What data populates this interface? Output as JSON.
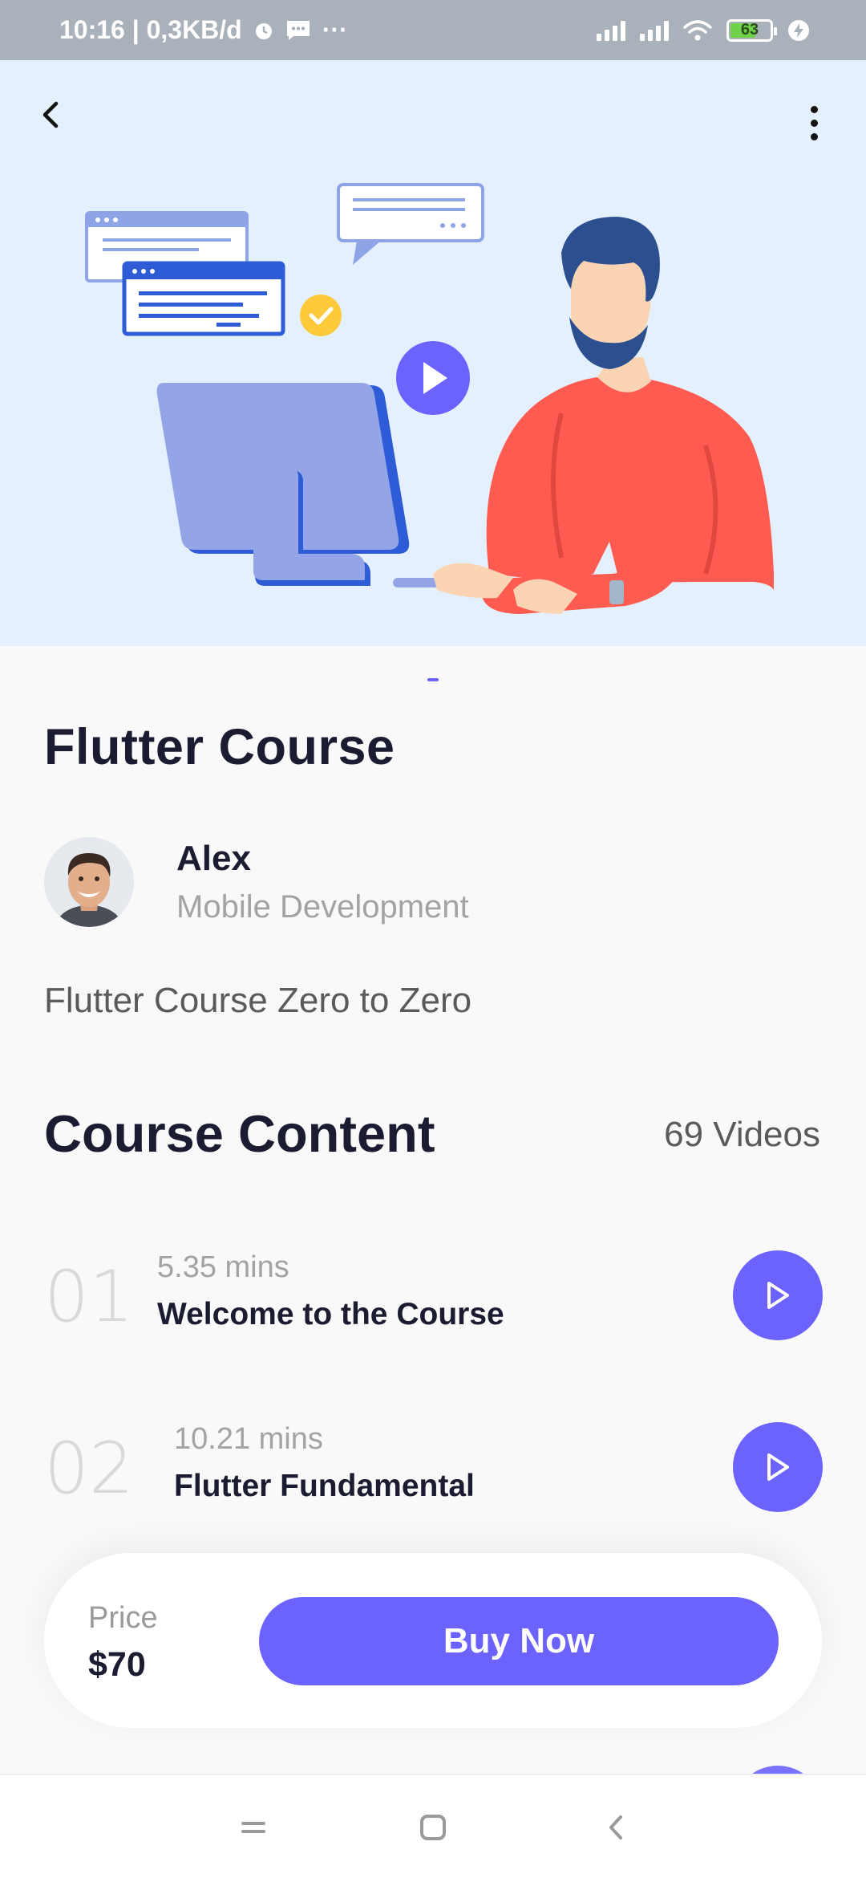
{
  "status_bar": {
    "time_and_speed": "10:16 | 0,3KB/d",
    "battery_level": "63",
    "more_dots": "···"
  },
  "course": {
    "title": "Flutter Course",
    "description": "Flutter Course Zero to Zero"
  },
  "author": {
    "name": "Alex",
    "role": "Mobile Development"
  },
  "content": {
    "title": "Course Content",
    "video_count": "69 Videos",
    "lessons": [
      {
        "number": "01",
        "duration": "5.35 mins",
        "title": "Welcome to the Course"
      },
      {
        "number": "02",
        "duration": "10.21 mins",
        "title": "Flutter Fundamental"
      }
    ]
  },
  "purchase": {
    "price_label": "Price",
    "price": "$70",
    "button_label": "Buy Now"
  },
  "colors": {
    "accent": "#6C63FF",
    "hero_background": "#E4F0FD",
    "page_background": "#F9F9F9",
    "text_dark": "#1B1B31",
    "text_muted": "#A3A3A3"
  },
  "icons": {
    "back": "chevron-left-icon",
    "more": "more-vertical-icon",
    "play": "play-icon",
    "nav_menu": "menu-icon",
    "nav_home": "square-icon",
    "nav_back": "back-icon"
  }
}
